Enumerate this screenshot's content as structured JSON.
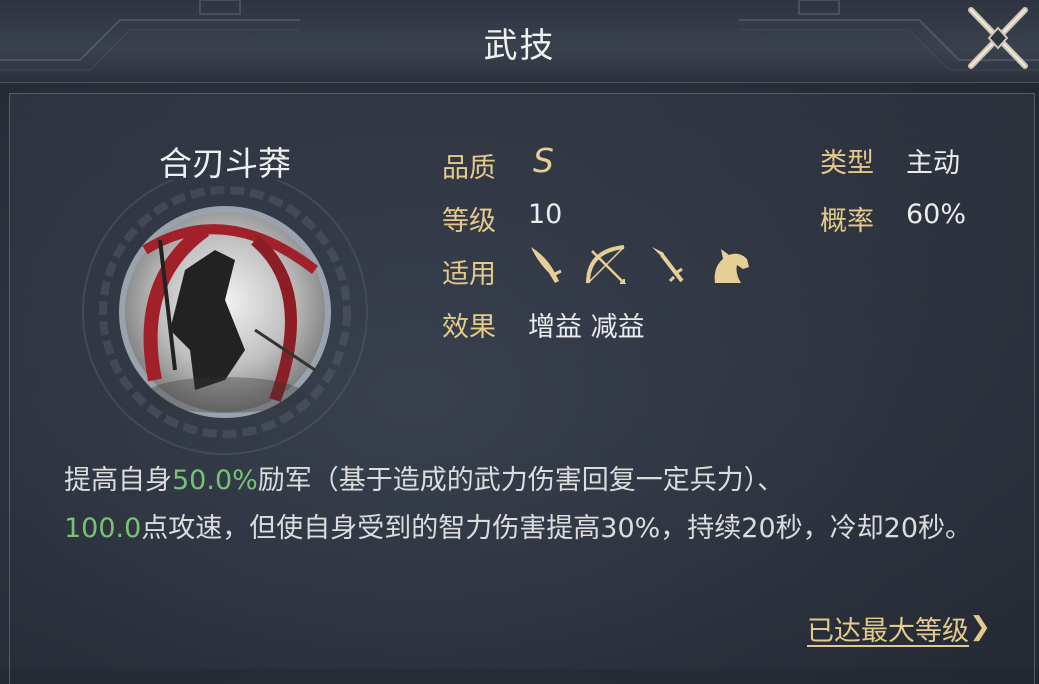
{
  "window": {
    "title": "武技"
  },
  "skill": {
    "name": "合刃斗莽",
    "quality_label": "品质",
    "quality_value": "S",
    "level_label": "等级",
    "level_value": "10",
    "applicable_label": "适用",
    "applicable_icons": [
      "saber-icon",
      "bow-icon",
      "spear-icon",
      "horse-icon"
    ],
    "effect_label": "效果",
    "effect_value": "增益 减益",
    "type_label": "类型",
    "type_value": "主动",
    "chance_label": "概率",
    "chance_value": "60%"
  },
  "description": {
    "p1": "提高自身",
    "v1": "50.0%",
    "p2": "励军（基于造成的武力伤害回复一定兵力）、",
    "v2": "100.0",
    "p3": "点攻速，但使自身受到的智力伤害提高30%，持续20秒，冷却20秒。"
  },
  "footer": {
    "max_level_label": "已达最大等级",
    "arrow": "❯"
  },
  "colors": {
    "label": "#e3c98b",
    "highlight": "#78c277",
    "value": "#ececec"
  }
}
